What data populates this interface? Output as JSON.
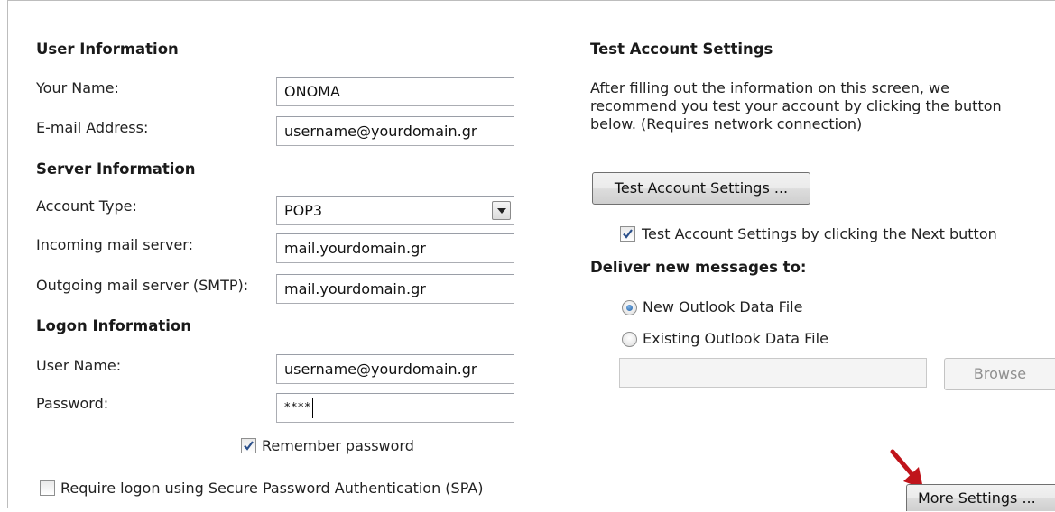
{
  "user_info": {
    "heading": "User Information",
    "your_name_label": "Your Name:",
    "your_name_value": "ONOMA",
    "email_label": "E-mail Address:",
    "email_value": "username@yourdomain.gr"
  },
  "server_info": {
    "heading": "Server Information",
    "account_type_label": "Account Type:",
    "account_type_value": "POP3",
    "incoming_label": "Incoming mail server:",
    "incoming_value": "mail.yourdomain.gr",
    "outgoing_label": "Outgoing mail server (SMTP):",
    "outgoing_value": "mail.yourdomain.gr"
  },
  "logon_info": {
    "heading": "Logon Information",
    "username_label": "User Name:",
    "username_value": "username@yourdomain.gr",
    "password_label": "Password:",
    "password_value": "****",
    "remember_label": "Remember password",
    "remember_checked": true,
    "spa_label": "Require logon using Secure Password Authentication (SPA)",
    "spa_checked": false
  },
  "test_settings": {
    "heading": "Test Account Settings",
    "description_lines": [
      "After filling out the information on this screen, we",
      "recommend you test your account by clicking the button",
      "below. (Requires network connection)"
    ],
    "test_button": "Test Account Settings ...",
    "next_checkbox_label": "Test Account Settings by clicking the Next button",
    "next_checkbox_checked": true
  },
  "deliver": {
    "heading": "Deliver new messages to:",
    "option_new": "New Outlook Data File",
    "option_existing": "Existing Outlook Data File",
    "selected": "new",
    "path_value": "",
    "browse_button": "Browse"
  },
  "more_settings_button": "More Settings ...",
  "colors": {
    "arrow": "#c0141b",
    "check": "#2a4f8a",
    "radio_dot": "#1f5fa6"
  }
}
